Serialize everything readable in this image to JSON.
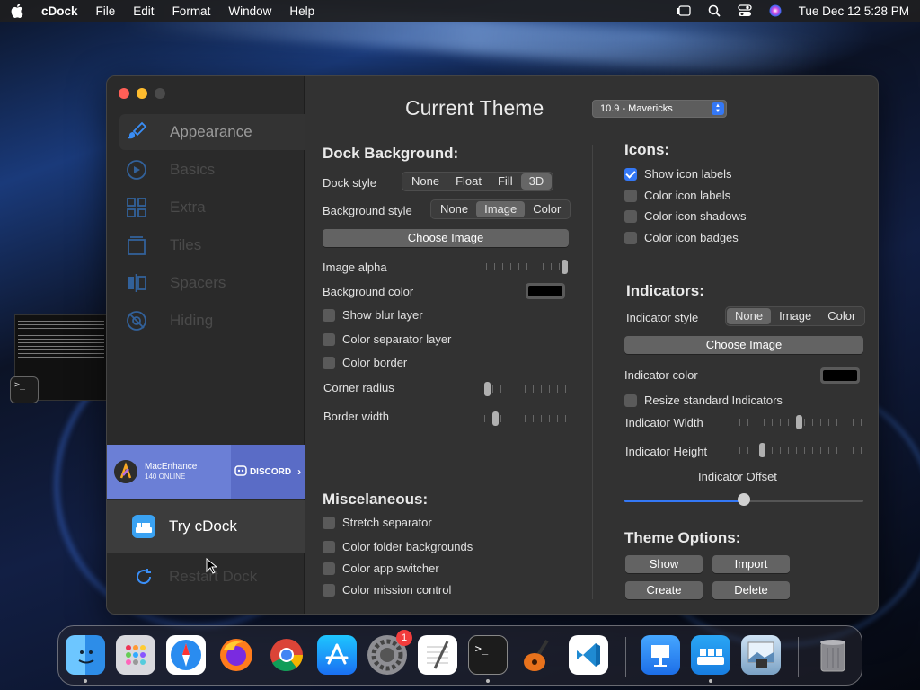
{
  "menubar": {
    "app_name": "cDock",
    "menus": [
      "File",
      "Edit",
      "Format",
      "Window",
      "Help"
    ],
    "datetime": "Tue Dec 12  5:28 PM"
  },
  "sidebar": {
    "items": [
      {
        "label": "Appearance",
        "icon": "paintbrush-icon",
        "active": true
      },
      {
        "label": "Basics",
        "icon": "speedometer-icon"
      },
      {
        "label": "Extra",
        "icon": "grid-icon"
      },
      {
        "label": "Tiles",
        "icon": "tiles-icon"
      },
      {
        "label": "Spacers",
        "icon": "spacer-icon"
      },
      {
        "label": "Hiding",
        "icon": "eye-slash-icon"
      }
    ],
    "discord": {
      "name": "MacEnhance",
      "online": "140 ONLINE",
      "button": "DISCORD"
    },
    "try_label": "Try cDock",
    "restart_label": "Restart Dock"
  },
  "header": {
    "title": "Current Theme",
    "theme_select": "10.9 - Mavericks"
  },
  "dock_background": {
    "heading": "Dock Background:",
    "dock_style": {
      "label": "Dock style",
      "options": [
        "None",
        "Float",
        "Fill",
        "3D"
      ],
      "selected": "3D"
    },
    "background_style": {
      "label": "Background style",
      "options": [
        "None",
        "Image",
        "Color"
      ],
      "selected": "Image"
    },
    "choose_image": "Choose Image",
    "image_alpha": {
      "label": "Image alpha",
      "value": 0.94
    },
    "background_color": {
      "label": "Background color",
      "color": "#000000"
    },
    "checkboxes": [
      {
        "label": "Show blur layer",
        "checked": false
      },
      {
        "label": "Color separator layer",
        "checked": false
      },
      {
        "label": "Color border",
        "checked": false
      }
    ],
    "corner_radius": {
      "label": "Corner radius",
      "value": 0.0
    },
    "border_width": {
      "label": "Border width",
      "value": 0.1
    }
  },
  "icons": {
    "heading": "Icons:",
    "checkboxes": [
      {
        "label": "Show icon labels",
        "checked": true
      },
      {
        "label": "Color icon labels",
        "checked": false
      },
      {
        "label": "Color icon shadows",
        "checked": false
      },
      {
        "label": "Color icon badges",
        "checked": false
      }
    ]
  },
  "indicators": {
    "heading": "Indicators:",
    "style": {
      "label": "Indicator style",
      "options": [
        "None",
        "Image",
        "Color"
      ],
      "selected": "None"
    },
    "choose_image": "Choose Image",
    "color": {
      "label": "Indicator color",
      "color": "#000000"
    },
    "resize": {
      "label": "Resize standard Indicators",
      "checked": false
    },
    "width": {
      "label": "Indicator Width",
      "value": 0.47
    },
    "height": {
      "label": "Indicator Height",
      "value": 0.16
    },
    "offset": {
      "label": "Indicator Offset",
      "value": 0.5
    }
  },
  "misc": {
    "heading": "Miscelaneous:",
    "checkboxes": [
      {
        "label": "Stretch separator",
        "checked": false
      },
      {
        "label": "Color folder backgrounds",
        "checked": false
      },
      {
        "label": "Color app switcher",
        "checked": false
      },
      {
        "label": "Color mission control",
        "checked": false
      }
    ]
  },
  "theme_options": {
    "heading": "Theme Options:",
    "show": "Show",
    "import": "Import",
    "create": "Create",
    "delete": "Delete"
  },
  "dock": {
    "apps": [
      "Finder",
      "Launchpad",
      "Safari",
      "Firefox",
      "Chrome",
      "App Store",
      "System Settings",
      "TextEdit",
      "Terminal",
      "GarageBand",
      "Visual Studio Code",
      "Keynote",
      "cDock",
      "Preview",
      "Trash"
    ],
    "settings_badge": "1"
  },
  "terminal_thumb": {
    "prompt": ">_"
  }
}
